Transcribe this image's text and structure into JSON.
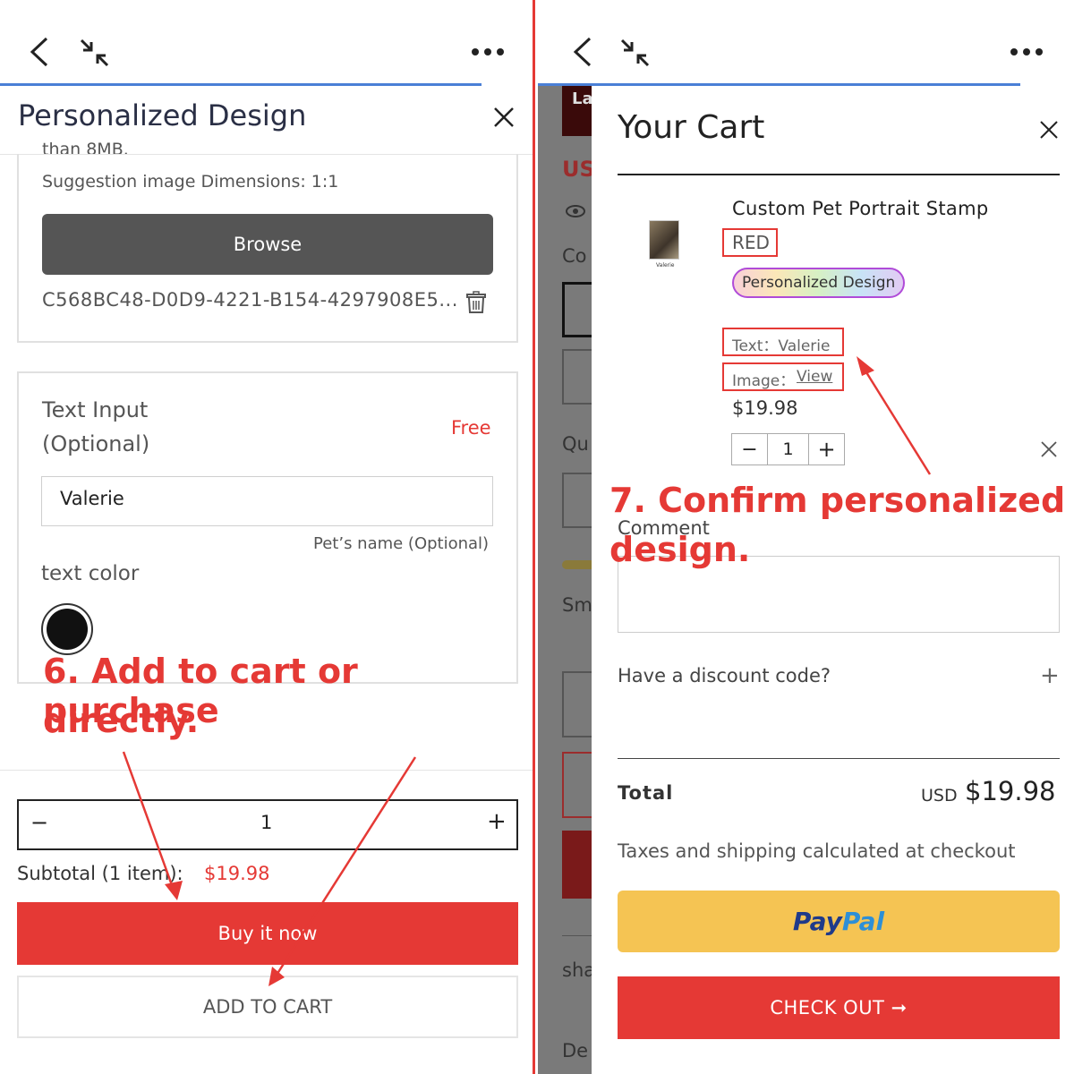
{
  "left": {
    "title": "Personalized Design",
    "upload": {
      "truncated_note": "than 8MB.",
      "dimension_hint": "Suggestion image Dimensions: 1:1",
      "browse_label": "Browse",
      "file_name": "C568BC48-D0D9-4221-B154-4297908E5..."
    },
    "text_input": {
      "label_line1": "Text Input",
      "label_line2": "(Optional)",
      "price": "Free",
      "value": "Valerie",
      "hint": "Pet’s name (Optional)",
      "color_label": "text color",
      "selected_color": "#111111"
    },
    "annotation_line1": "6. Add to cart or purchase",
    "annotation_line2": "directly.",
    "quantity": {
      "minus": "−",
      "value": "1",
      "plus": "+"
    },
    "subtotal_label": "Subtotal (1 item):",
    "subtotal_value": "$19.98",
    "buy_now_label": "Buy it now",
    "add_to_cart_label": "ADD TO CART"
  },
  "right": {
    "bg_fragments": {
      "usd": "US",
      "co": "Co",
      "qu": "Qu",
      "sm": "Sm",
      "sha": "sha",
      "de": "De",
      "la": "La"
    },
    "cart_title": "Your Cart",
    "item": {
      "name": "Custom Pet Portrait Stamp",
      "variant": "RED",
      "badge": "Personalized Design",
      "text_line": "Text：Valerie",
      "image_label": "Image：",
      "image_link": "View",
      "thumb_caption": "Valerie",
      "price": "$19.98",
      "qty_minus": "−",
      "qty_value": "1",
      "qty_plus": "+"
    },
    "annotation_line1": "7. Confirm personalized",
    "annotation_line2": "design.",
    "comment_label": "Comment",
    "discount_label": "Have a discount code?",
    "discount_plus": "+",
    "total_label": "Total",
    "total_currency": "USD",
    "total_value": "$19.98",
    "tax_note": "Taxes and shipping calculated at checkout",
    "paypal_pay": "Pay",
    "paypal_pal": "Pal",
    "checkout_label": "CHECK OUT ➞"
  },
  "colors": {
    "accent_red": "#e53935",
    "top_line_blue": "#4a7fd6",
    "paypal_yellow": "#f5c453",
    "browse_gray": "#555555"
  }
}
